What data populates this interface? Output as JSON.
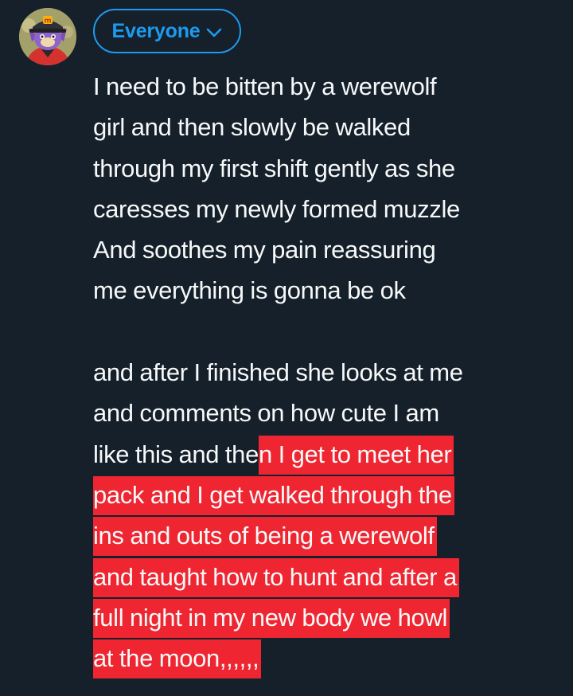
{
  "composer": {
    "audience_label": "Everyone",
    "avatar_badge": "m"
  },
  "post": {
    "paragraph_1": [
      "I need to be bitten by a werewolf",
      "girl and then slowly be walked",
      "through my first shift gently as she",
      "caresses my newly formed muzzle",
      "And soothes my pain reassuring",
      "me everything is gonna be ok"
    ],
    "paragraph_2": {
      "plain_lines": [
        "and after I finished she looks at me",
        "and comments on how cute I am"
      ],
      "line_3_plain": "like this and the",
      "line_3_highlighted": "n I get to meet her",
      "highlighted_lines": [
        "pack and I get walked through the",
        "ins and outs of being a werewolf",
        "and taught how to hunt and after a",
        "full night in my new body we howl",
        "at the moon,,,,,,"
      ]
    }
  },
  "colors": {
    "background": "#15202b",
    "text": "#f7f9f9",
    "accent": "#1d9bf0",
    "highlight": "#ef2631"
  }
}
